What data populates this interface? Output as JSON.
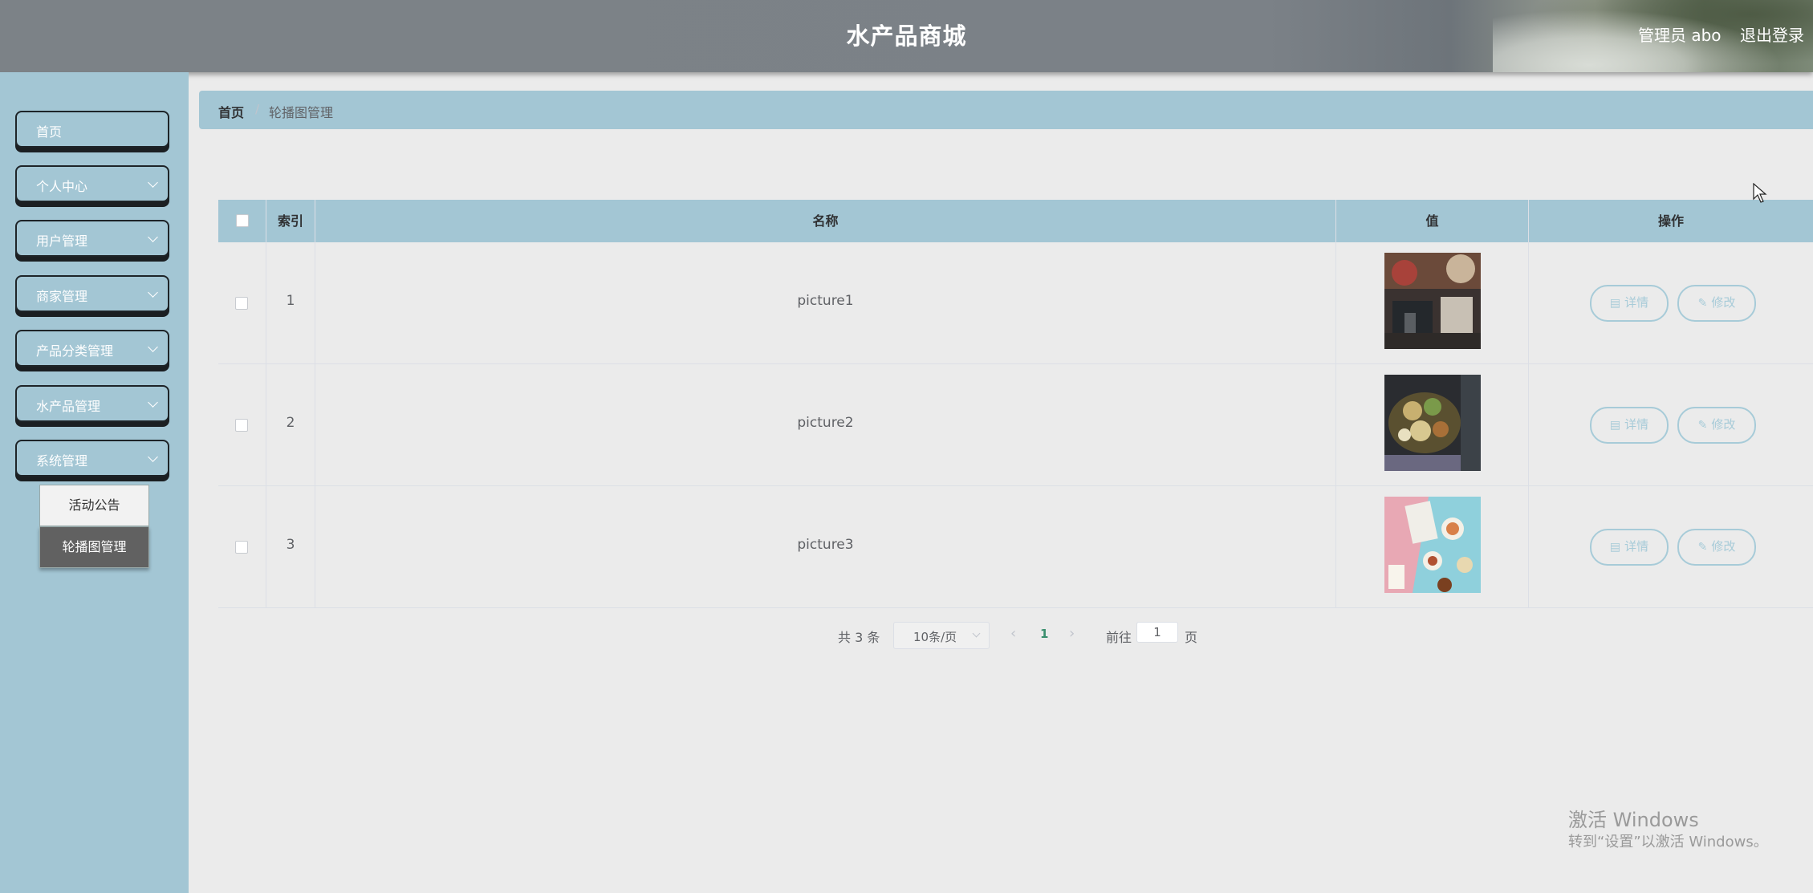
{
  "header": {
    "title": "水产品商城",
    "user": "管理员 abo",
    "logout": "退出登录"
  },
  "sidebar": {
    "items": [
      {
        "label": "首页",
        "has_children": false
      },
      {
        "label": "个人中心",
        "has_children": true
      },
      {
        "label": "用户管理",
        "has_children": true
      },
      {
        "label": "商家管理",
        "has_children": true
      },
      {
        "label": "产品分类管理",
        "has_children": true
      },
      {
        "label": "水产品管理",
        "has_children": true
      },
      {
        "label": "系统管理",
        "has_children": true
      }
    ],
    "submenu": [
      {
        "label": "活动公告"
      },
      {
        "label": "轮播图管理"
      }
    ]
  },
  "breadcrumb": {
    "home": "首页",
    "separator": "/",
    "current": "轮播图管理"
  },
  "table": {
    "columns": [
      "索引",
      "名称",
      "值",
      "操作"
    ],
    "rows": [
      {
        "index": "1",
        "name": "picture1",
        "value_image": "photo-thumbnail-1"
      },
      {
        "index": "2",
        "name": "picture2",
        "value_image": "photo-thumbnail-2"
      },
      {
        "index": "3",
        "name": "picture3",
        "value_image": "photo-thumbnail-3"
      }
    ],
    "actions": {
      "detail": "详情",
      "edit": "修改"
    }
  },
  "pagination": {
    "total": "共 3 条",
    "page_size": "10条/页",
    "current_page": "1",
    "goto_label": "前往",
    "goto_value": "1",
    "page_suffix": "页"
  },
  "watermark": {
    "title": "激活 Windows",
    "subtitle": "转到“设置”以激活 Windows。"
  },
  "colors": {
    "header": "#7c8287",
    "sidebar": "#a3c6d4",
    "button_outline": "#a7cbd8",
    "content_bg": "#ebebeb"
  }
}
